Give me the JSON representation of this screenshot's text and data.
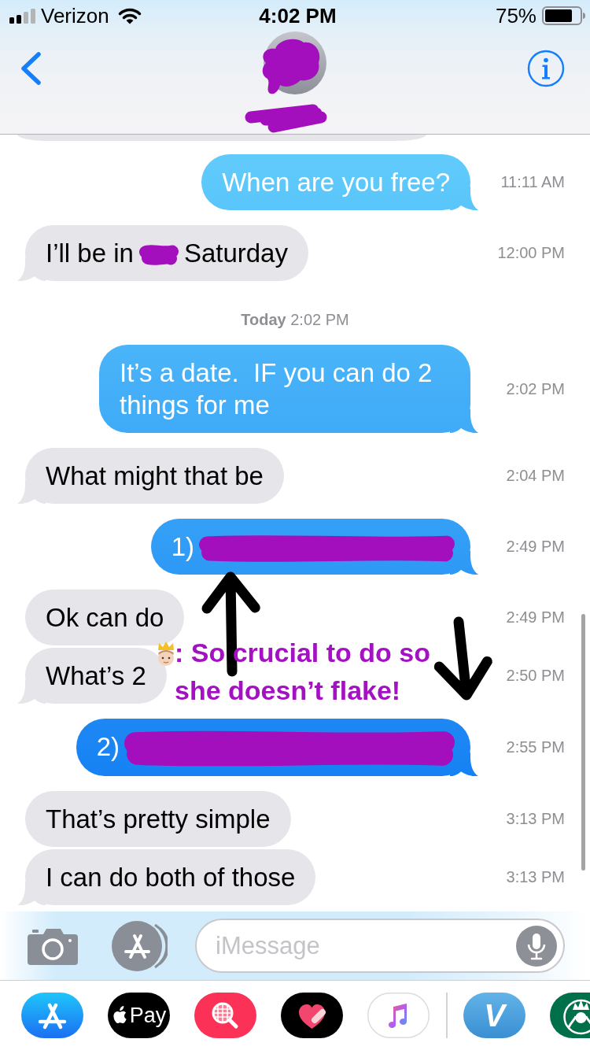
{
  "status_bar": {
    "carrier": "Verizon",
    "time": "4:02 PM",
    "battery": "75%"
  },
  "header": {
    "contact_redacted": true
  },
  "thread": {
    "cut_off": {
      "kind": "received"
    },
    "items": [
      {
        "kind": "sent",
        "tail": true,
        "parts": [
          {
            "kind": "text",
            "text": "When are you free?"
          }
        ],
        "time": "11:11 AM"
      },
      {
        "kind": "received",
        "tail": true,
        "parts": [
          {
            "kind": "text",
            "text": "I’ll be in"
          },
          {
            "kind": "blot"
          },
          {
            "kind": "text",
            "text": "Saturday"
          }
        ],
        "time": "12:00 PM"
      },
      {
        "kind": "date",
        "text": "**Today** 2:02 PM"
      },
      {
        "kind": "sent",
        "tail": true,
        "parts": [
          {
            "kind": "text",
            "text": "It’s a date.  IF you can do 2 things for me"
          }
        ],
        "time": "2:02 PM"
      },
      {
        "kind": "received",
        "tail": true,
        "parts": [
          {
            "kind": "text",
            "text": "What might that be"
          }
        ],
        "time": "2:04 PM"
      },
      {
        "kind": "sent",
        "tail": true,
        "parts": [
          {
            "kind": "text",
            "text": "1)"
          },
          {
            "kind": "streak"
          }
        ],
        "time": "2:49 PM"
      },
      {
        "kind": "received",
        "tail": false,
        "parts": [
          {
            "kind": "text",
            "text": "Ok can do"
          }
        ],
        "time": "2:49 PM"
      },
      {
        "kind": "received",
        "tail": true,
        "parts": [
          {
            "kind": "text",
            "text": "What’s 2"
          }
        ],
        "time": "2:50 PM"
      },
      {
        "kind": "sent",
        "tail": true,
        "parts": [
          {
            "kind": "text",
            "text": "2)"
          },
          {
            "kind": "band"
          }
        ],
        "time": "2:55 PM"
      },
      {
        "kind": "received",
        "tail": false,
        "parts": [
          {
            "kind": "text",
            "text": "That’s pretty simple"
          }
        ],
        "time": "3:13 PM"
      },
      {
        "kind": "received",
        "tail": true,
        "parts": [
          {
            "kind": "text",
            "text": "I can do both of those"
          }
        ],
        "time": "3:13 PM"
      }
    ]
  },
  "annotation": {
    "text": ": So crucial to do so\nshe doesn’t flake!",
    "arrows": [
      {
        "kind": "up"
      },
      {
        "kind": "down"
      }
    ]
  },
  "composer": {
    "placeholder": "iMessage"
  },
  "app_drawer": [
    {
      "kind": "app-store"
    },
    {
      "kind": "apple-pay",
      "label": "Pay"
    },
    {
      "kind": "search"
    },
    {
      "kind": "heart"
    },
    {
      "kind": "music"
    },
    {
      "kind": "divider"
    },
    {
      "kind": "venmo",
      "label": "V"
    },
    {
      "kind": "starbucks"
    }
  ]
}
